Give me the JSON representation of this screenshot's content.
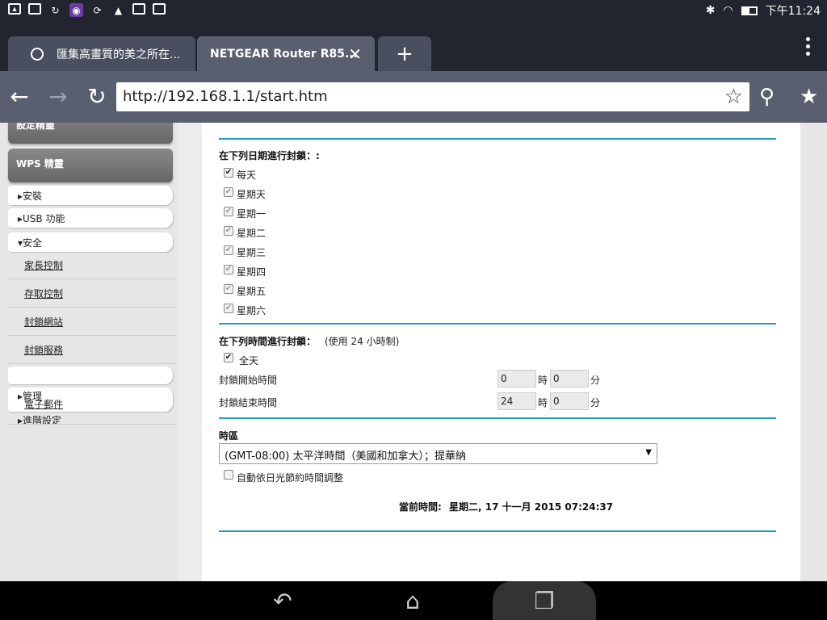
{
  "status": {
    "time": "下午11:24"
  },
  "tabs": [
    {
      "label": "匯集高畫質的美之所在..."
    },
    {
      "label": "NETGEAR Router R85...",
      "close": "✕"
    },
    {
      "label": "+"
    }
  ],
  "toolbar": {
    "url": "http://192.168.1.1/start.htm"
  },
  "sidebar": {
    "setup_wizard": "設定精靈",
    "wps_wizard": "WPS 精靈",
    "items": [
      "▸安裝",
      "▸USB 功能",
      "▾安全"
    ],
    "security_sub": [
      "家長控制",
      "存取控制",
      "封鎖網站",
      "封鎖服務"
    ],
    "admin": "▸管理",
    "email": "電子郵件",
    "advanced": "▸進階設定"
  },
  "schedule": {
    "days_title": "在下列日期進行封鎖：:",
    "every_day": "每天",
    "days": [
      "星期天",
      "星期一",
      "星期二",
      "星期三",
      "星期四",
      "星期五",
      "星期六"
    ],
    "time_title": "在下列時間進行封鎖：",
    "time_note": "(使用 24 小時制)",
    "all_day": "全天",
    "start_label": "封鎖開始時間",
    "end_label": "封鎖結束時間",
    "start_hour": "0",
    "start_min": "0",
    "end_hour": "24",
    "end_min": "0",
    "hour_unit": "時",
    "min_unit": "分",
    "tz_title": "時區",
    "tz_value": "(GMT-08:00) 太平洋時間（美國和加拿大）；提華納",
    "dst_label": "自動依日光節約時間調整",
    "current_time_label": "當前時間:",
    "current_time": "星期二, 17 十一月 2015 07:24:37"
  },
  "colors": {
    "accent": "#2a9bb5",
    "chrome": "#222530",
    "toolbar": "#5a5f70"
  }
}
